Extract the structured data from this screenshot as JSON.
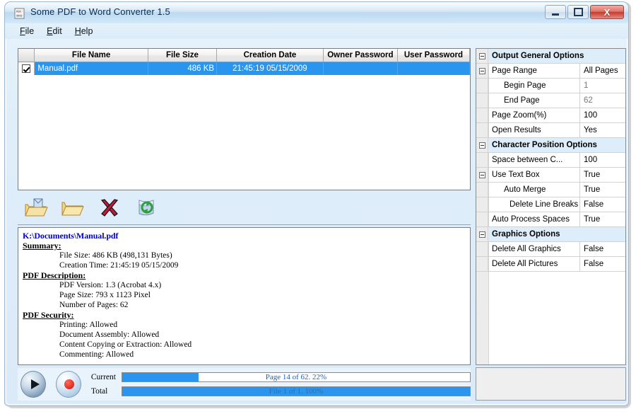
{
  "window": {
    "title": "Some PDF to Word Converter 1.5",
    "app_icon": "pdf-to-word-icon",
    "minimize_label": "Minimize",
    "maximize_label": "Maximize",
    "close_label": "X"
  },
  "menubar": {
    "items": [
      {
        "accel": "F",
        "rest": "ile"
      },
      {
        "accel": "E",
        "rest": "dit"
      },
      {
        "accel": "H",
        "rest": "elp"
      }
    ]
  },
  "filelist": {
    "columns": [
      "File Name",
      "File Size",
      "Creation Date",
      "Owner Password",
      "User Password"
    ],
    "rows": [
      {
        "checked": true,
        "file_name": "Manual.pdf",
        "file_size": "486 KB",
        "creation_date": "21:45:19 05/15/2009",
        "owner_password": "",
        "user_password": ""
      }
    ]
  },
  "toolbar": {
    "buttons": [
      {
        "name": "add-files-icon",
        "tooltip": "Add PDF Files"
      },
      {
        "name": "open-folder-icon",
        "tooltip": "Add Folder"
      },
      {
        "name": "remove-red-x-icon",
        "tooltip": "Remove"
      },
      {
        "name": "clear-refresh-icon",
        "tooltip": "Clear List"
      }
    ]
  },
  "info": {
    "path": "K:\\Documents\\Manual.pdf",
    "sections": [
      {
        "heading": "Summary:",
        "lines": [
          "File Size: 486 KB (498,131 Bytes)",
          "Creation Time: 21:45:19 05/15/2009"
        ]
      },
      {
        "heading": "PDF Description:",
        "lines": [
          "PDF Version: 1.3 (Acrobat 4.x)",
          "Page Size: 793 x 1123 Pixel",
          "Number of Pages: 62"
        ]
      },
      {
        "heading": "PDF Security:",
        "lines": [
          "Printing: Allowed",
          "Document Assembly: Allowed",
          "Content Copying or Extraction: Allowed",
          "Commenting: Allowed"
        ]
      }
    ]
  },
  "status": {
    "play_button": "start-convert-button",
    "stop_button": "stop-convert-button",
    "current_label": "Current",
    "total_label": "Total",
    "current_text": "Page 14 of 62. 22%",
    "current_percent": 22,
    "total_text": "File 1 of 1. 100%",
    "total_percent": 100,
    "bar_color": "#2a95ef"
  },
  "options": {
    "rows": [
      {
        "type": "category",
        "expander": true,
        "name": "Output General Options",
        "value": ""
      },
      {
        "type": "prop",
        "expander": true,
        "indent": 0,
        "name": "Page Range",
        "value": "All Pages",
        "dim": false
      },
      {
        "type": "prop",
        "expander": false,
        "indent": 1,
        "name": "Begin Page",
        "value": "1",
        "dim": true
      },
      {
        "type": "prop",
        "expander": false,
        "indent": 1,
        "name": "End Page",
        "value": "62",
        "dim": true
      },
      {
        "type": "prop",
        "expander": false,
        "indent": 0,
        "name": "Page Zoom(%)",
        "value": "100",
        "dim": false
      },
      {
        "type": "prop",
        "expander": false,
        "indent": 0,
        "name": "Open Results",
        "value": "Yes",
        "dim": false
      },
      {
        "type": "category",
        "expander": true,
        "name": "Character Position Options",
        "value": ""
      },
      {
        "type": "prop",
        "expander": false,
        "indent": 0,
        "name": "Space between C...",
        "value": "100",
        "dim": false
      },
      {
        "type": "prop",
        "expander": true,
        "indent": 0,
        "name": "Use  Text Box",
        "value": "True",
        "dim": false
      },
      {
        "type": "prop",
        "expander": false,
        "indent": 1,
        "name": "Auto Merge",
        "value": "True",
        "dim": false
      },
      {
        "type": "prop",
        "expander": false,
        "indent": 2,
        "name": "Delete Line Breaks",
        "value": "False",
        "dim": false
      },
      {
        "type": "prop",
        "expander": false,
        "indent": 0,
        "name": "Auto Process Spaces",
        "value": "True",
        "dim": false
      },
      {
        "type": "category",
        "expander": true,
        "name": "Graphics Options",
        "value": ""
      },
      {
        "type": "prop",
        "expander": false,
        "indent": 0,
        "name": "Delete All Graphics",
        "value": "False",
        "dim": false
      },
      {
        "type": "prop",
        "expander": false,
        "indent": 0,
        "name": "Delete All Pictures",
        "value": "False",
        "dim": false
      }
    ]
  }
}
